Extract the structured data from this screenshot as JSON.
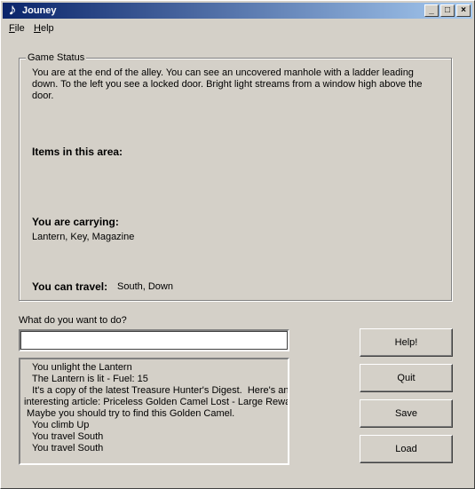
{
  "window": {
    "title": "Jouney",
    "controls": {
      "minimize": "_",
      "maximize": "□",
      "close": "×"
    }
  },
  "menu": {
    "file": {
      "mnemonic": "F",
      "rest": "ile"
    },
    "help": {
      "mnemonic": "H",
      "rest": "elp"
    }
  },
  "game_status": {
    "label": "Game Status",
    "description": "You are at the end of the alley.  You can see an uncovered manhole with a ladder leading down.  To the left you see a locked door.  Bright light streams from a window high above the door.",
    "items_heading": "Items in this area:",
    "items_value": "",
    "carrying_heading": "You are carrying:",
    "carrying_value": "Lantern, Key, Magazine",
    "travel_heading": "You can travel:",
    "travel_value": "South, Down"
  },
  "command": {
    "prompt": "What do you want to do?",
    "value": ""
  },
  "log": [
    "   You unlight the Lantern",
    "   The Lantern is lit - Fuel: 15",
    "   It's a copy of the latest Treasure Hunter's Digest.  Here's an",
    "interesting article: Priceless Golden Camel Lost - Large Reward.",
    " Maybe you should try to find this Golden Camel.",
    "   You climb Up",
    "   You travel South",
    "   You travel South"
  ],
  "buttons": {
    "help": "Help!",
    "quit": "Quit",
    "save": "Save",
    "load": "Load"
  }
}
